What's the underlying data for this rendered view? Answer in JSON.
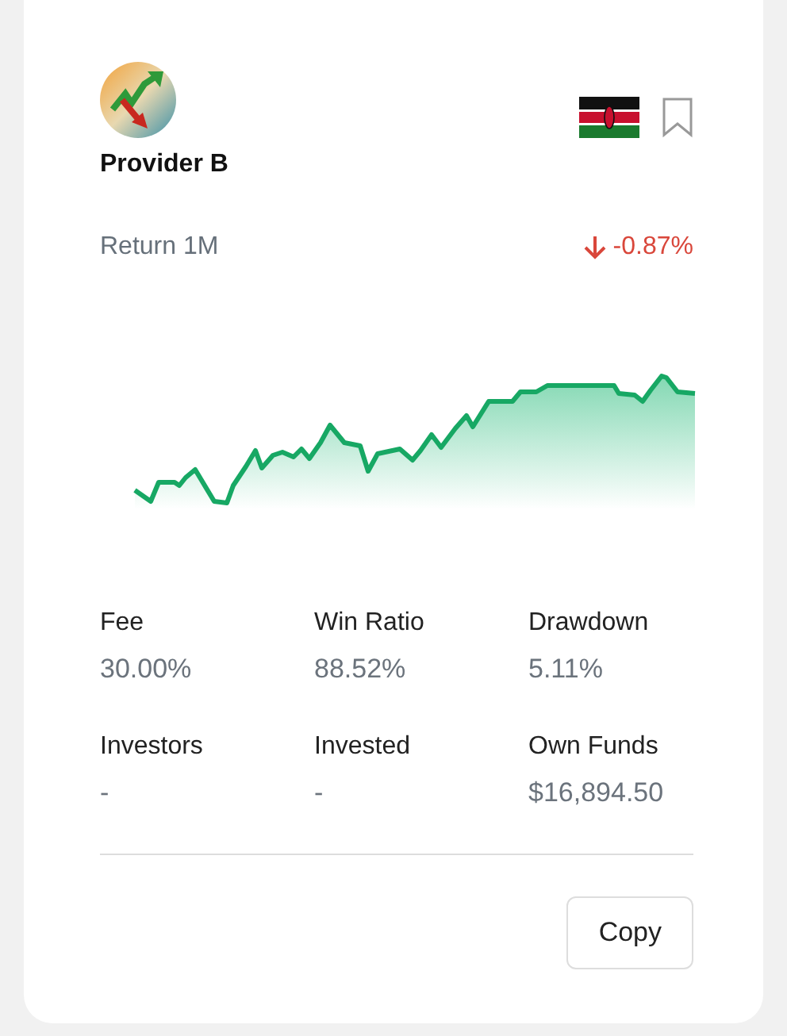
{
  "provider": {
    "name": "Provider B",
    "bookmarked": false
  },
  "return": {
    "label": "Return 1M",
    "value": "-0.87%",
    "kind": "down"
  },
  "stats": [
    {
      "label": "Fee",
      "value": "30.00%"
    },
    {
      "label": "Win Ratio",
      "value": "88.52%"
    },
    {
      "label": "Drawdown",
      "value": "5.11%"
    },
    {
      "label": "Investors",
      "value": "-"
    },
    {
      "label": "Invested",
      "value": "-"
    },
    {
      "label": "Own Funds",
      "value": "$16,894.50"
    }
  ],
  "buttons": [
    "Copy"
  ]
}
